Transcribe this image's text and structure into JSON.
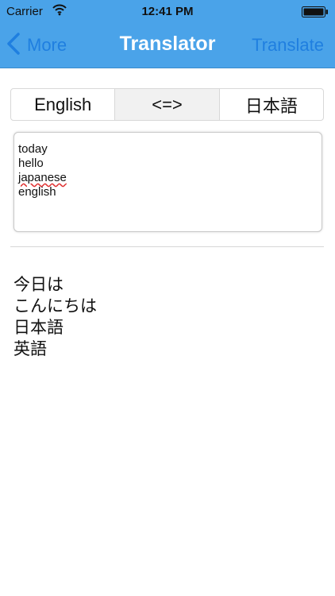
{
  "status_bar": {
    "carrier": "Carrier",
    "time": "12:41 PM",
    "wifi_icon": "wifi-icon",
    "battery_icon": "battery-icon"
  },
  "nav": {
    "back_label": "More",
    "back_icon": "chevron-left-icon",
    "title": "Translator",
    "action_label": "Translate"
  },
  "segments": {
    "source": "English",
    "swap": "<=>",
    "target": "日本語",
    "selected": "swap"
  },
  "input": {
    "lines": [
      "today",
      "hello",
      "japanese",
      "english"
    ]
  },
  "output": {
    "lines": [
      "今日は",
      "こんにちは",
      "日本語",
      "英語"
    ]
  },
  "colors": {
    "nav_background": "#4aa3e9",
    "nav_link": "#1f7fe0",
    "nav_title": "#ffffff"
  }
}
